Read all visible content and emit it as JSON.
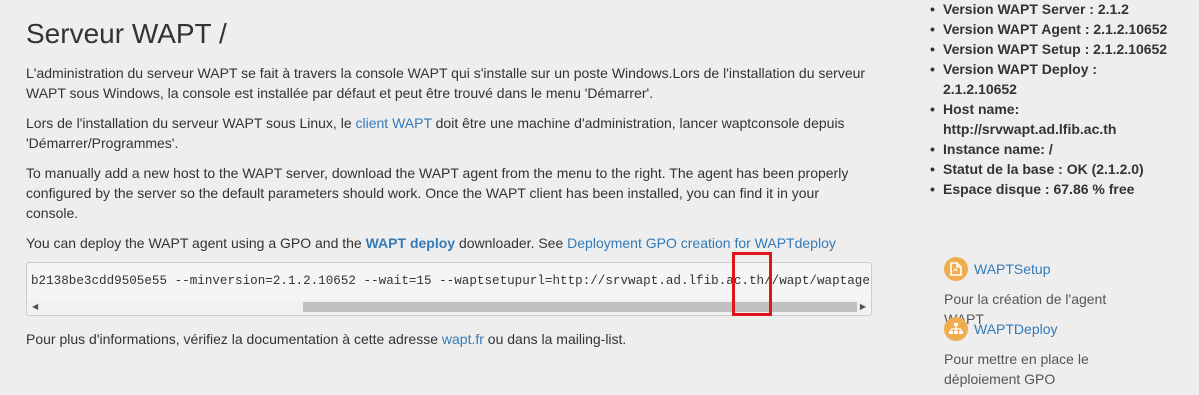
{
  "page": {
    "title": "Serveur WAPT /",
    "intro_fr": "L'administration du serveur WAPT se fait à travers la console WAPT qui s'installe sur un poste Windows.Lors de l'installation du serveur WAPT sous Windows, la console est installée par défaut et peut être trouvé dans le menu 'Démarrer'.",
    "linux_before": "Lors de l'installation du serveur WAPT sous Linux, le ",
    "linux_link": "client WAPT",
    "linux_after": " doit être une machine d'administration, lancer waptconsole depuis 'Démarrer/Programmes'.",
    "manual_add": "To manually add a new host to the WAPT server, download the WAPT agent from the menu to the right. The agent has been properly configured by the server so the default parameters should work. Once the WAPT client has been installed, you can find it in your console.",
    "gpo_before": "You can deploy the WAPT agent using a GPO and the ",
    "gpo_strong": "WAPT deploy",
    "gpo_middle": " downloader. See ",
    "gpo_link": "Deployment GPO creation for WAPTdeploy",
    "code_line": "b2138be3cdd9505e55 --minversion=2.1.2.10652 --wait=15 --waptsetupurl=http://srvwapt.ad.lfib.ac.th//wapt/waptagent.exe",
    "more_before": "Pour plus d'informations, vérifiez la documentation à cette adresse ",
    "more_link": "wapt.fr",
    "more_after": " ou dans la mailing-list."
  },
  "sidebar": {
    "info": [
      "Version WAPT Server : 2.1.2",
      "Version WAPT Agent : 2.1.2.10652",
      "Version WAPT Setup : 2.1.2.10652",
      "Version WAPT Deploy : 2.1.2.10652",
      "Host name: http://srvwapt.ad.lfib.ac.th",
      "Instance name: /",
      "Statut de la base : OK (2.1.2.0)",
      "Espace disque : 67.86 % free"
    ],
    "downloads": [
      {
        "label": "WAPTSetup",
        "icon": "file-icon",
        "desc": "Pour la création de l'agent WAPT"
      },
      {
        "label": "WAPTDeploy",
        "icon": "sitemap-icon",
        "desc": "Pour mettre en place le déploiement GPO"
      }
    ]
  },
  "colors": {
    "accent": "#337ab7",
    "icon_bg": "#f0ad4e",
    "highlight": "#e0141c"
  }
}
